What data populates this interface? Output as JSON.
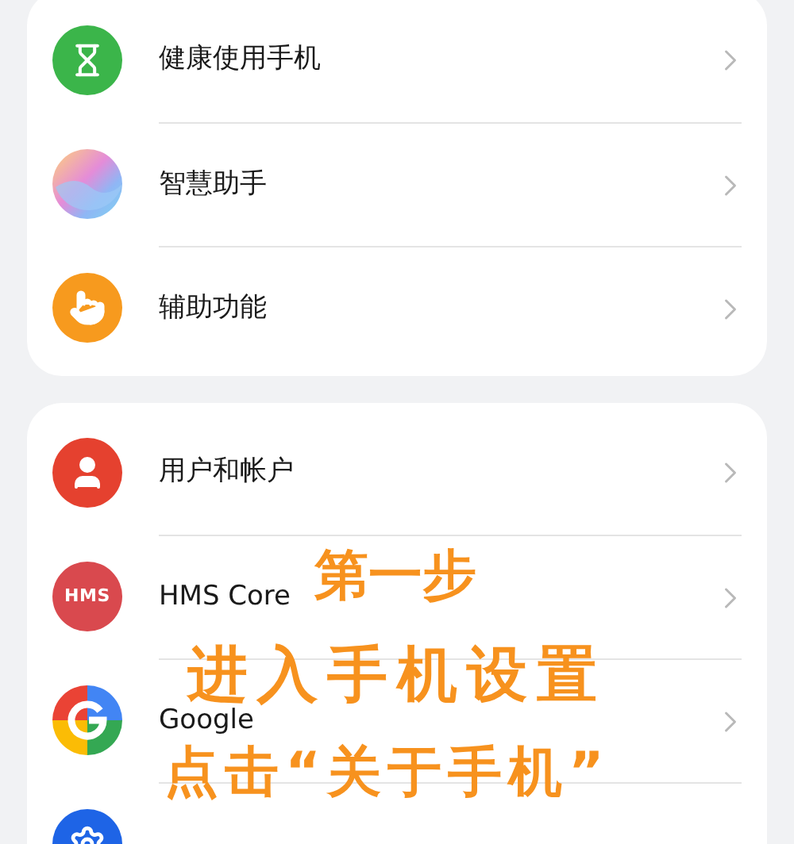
{
  "groups": [
    {
      "items": [
        {
          "kind": "hourglass",
          "label": "健康使用手机"
        },
        {
          "kind": "orb",
          "label": "智慧助手"
        },
        {
          "kind": "hand",
          "label": "辅助功能"
        }
      ]
    },
    {
      "items": [
        {
          "kind": "user",
          "label": "用户和帐户"
        },
        {
          "kind": "hms",
          "badge": "HMS",
          "label": "HMS Core"
        },
        {
          "kind": "google",
          "label": "Google"
        },
        {
          "kind": "gear"
        }
      ]
    }
  ],
  "annotation": {
    "lines": [
      "第一步",
      "进入手机设置",
      "点击“关于手机”"
    ]
  }
}
